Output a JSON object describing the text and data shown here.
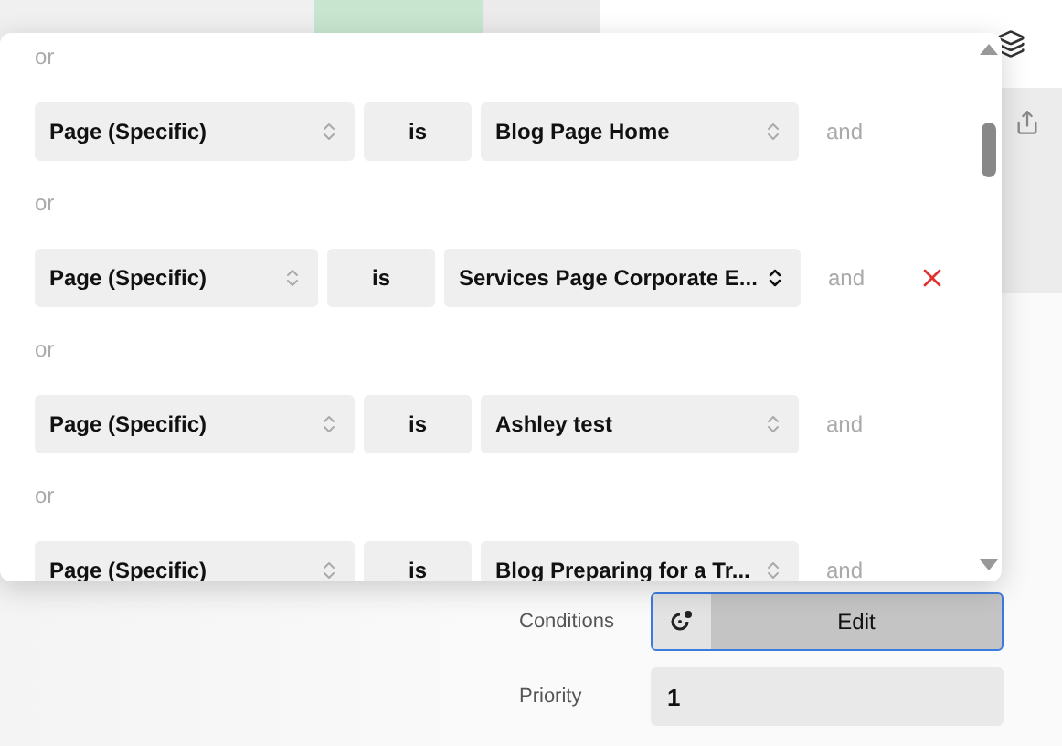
{
  "popup": {
    "rows": [
      {
        "or_label": "or",
        "field": "Page (Specific)",
        "operator": "is",
        "value": "Blog Page Home",
        "connector": "and",
        "hovered": false
      },
      {
        "or_label": "or",
        "field": "Page (Specific)",
        "operator": "is",
        "value": "Services Page Corporate E...",
        "connector": "and",
        "hovered": true
      },
      {
        "or_label": "or",
        "field": "Page (Specific)",
        "operator": "is",
        "value": "Ashley test",
        "connector": "and",
        "hovered": false
      },
      {
        "or_label": "or",
        "field": "Page (Specific)",
        "operator": "is",
        "value": "Blog Preparing for a Tr...",
        "connector": "and",
        "hovered": false
      }
    ]
  },
  "settings": [
    {
      "kind": "button",
      "label": "Conditions",
      "value": "Edit"
    },
    {
      "kind": "field",
      "label": "Priority",
      "value": "1"
    }
  ]
}
